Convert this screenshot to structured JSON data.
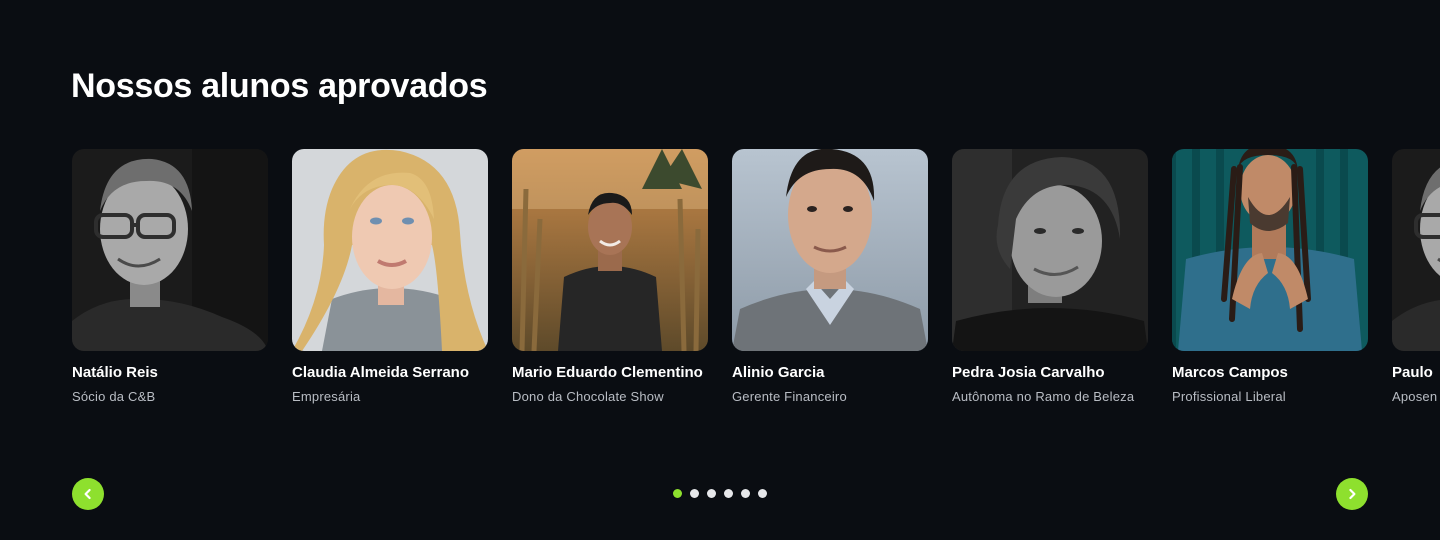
{
  "section": {
    "title": "Nossos alunos aprovados"
  },
  "students": [
    {
      "name": "Natálio Reis",
      "role": "Sócio da C&B",
      "photo": "portrait-man-glasses-bw"
    },
    {
      "name": "Claudia Almeida Serrano",
      "role": "Empresária",
      "photo": "portrait-woman-blonde"
    },
    {
      "name": "Mario Eduardo Clementino",
      "role": "Dono da Chocolate Show",
      "photo": "portrait-man-outdoor"
    },
    {
      "name": "Alinio Garcia",
      "role": "Gerente Financeiro",
      "photo": "portrait-man-suit"
    },
    {
      "name": "Pedra Josia Carvalho",
      "role": "Autônoma no Ramo de Beleza",
      "photo": "portrait-woman-bw"
    },
    {
      "name": "Marcos Campos",
      "role": "Profissional Liberal",
      "photo": "portrait-man-dreadlocks"
    },
    {
      "name": "Paulo",
      "role": "Aposen",
      "photo": "portrait-man-glasses-bw"
    }
  ],
  "pagination": {
    "pages": 6,
    "active_page": 1
  },
  "colors": {
    "background": "#0a0d12",
    "accent": "#8ee02e",
    "dot_inactive": "#e6e7ea",
    "role_text": "#b9bdc4"
  },
  "icons": {
    "prev": "chevron-left-icon",
    "next": "chevron-right-icon"
  }
}
